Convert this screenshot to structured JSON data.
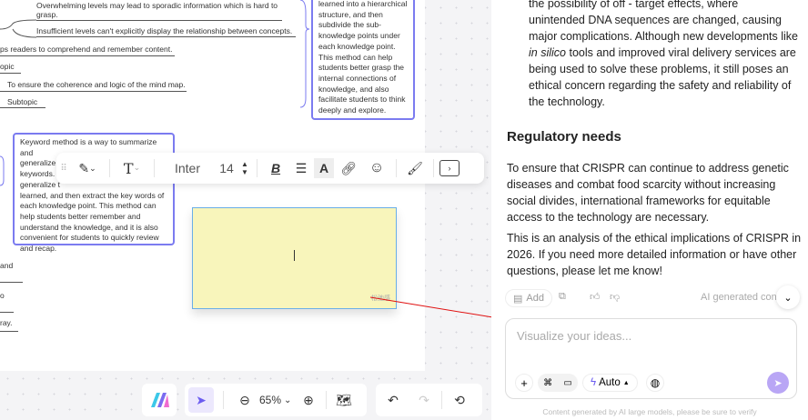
{
  "canvas": {
    "lines": [
      "Overwhelming levels may lead to sporadic information which is hard to",
      "grasp.",
      "Insufficient levels can't explicitly display the relationship between concepts.",
      "ps readers to comprehend and remember content.",
      "opic",
      "To ensure the coherence and logic of the mind map.",
      "Subtopic",
      "and",
      "o",
      "ray."
    ],
    "card_top": [
      "learned into a hierarchical",
      "structure, and then",
      "subdivide the sub-",
      "knowledge points under",
      "each knowledge point.",
      "This method can help",
      "students better grasp the",
      "internal connections of",
      "knowledge, and also",
      "facilitate students to think",
      "deeply and explore."
    ],
    "card_keyword": [
      "Keyword method is a way to summarize and",
      "generalize knowledge points with",
      "keywords. S",
      "generalize t",
      "learned, and then extract the key words of",
      "each knowledge point. This method can",
      "help students better remember and",
      "understand the knowledge, and it is also",
      "convenient for students to quickly review",
      "and recap."
    ],
    "sticky_label": "松弛感"
  },
  "toolbar": {
    "font": "Inter",
    "size": "14"
  },
  "bottom": {
    "zoom": "65%"
  },
  "panel": {
    "para1": [
      "the possibility of off - target effects, where",
      "unintended DNA sequences are changed, causing",
      "major complications. Although new developments like"
    ],
    "para1_italic": "in silico",
    "para1_rest": [
      " tools and improved viral delivery services are",
      "being used to solve these problems, it still poses an",
      "ethical concern regarding the safety and reliability of",
      "the technology."
    ],
    "heading": "Regulatory needs",
    "para2": "To ensure that CRISPR can continue to address genetic diseases and combat food scarcity without increasing social divides, international frameworks for equitable access to the technology are necessary.",
    "para3": "This is an analysis of the ethical implications of CRISPR in 2026. If you need more detailed information or have other questions, please let me know!",
    "add_label": "Add",
    "ai_label": "AI generated con",
    "input_placeholder": "Visualize your ideas...",
    "mode": "Auto",
    "footer": "Content generated by AI large models, please be sure to verify"
  },
  "colors": {
    "accent": "#7b7bf0",
    "sticky": "#f8f5bb",
    "send": "#b9a6f5"
  }
}
